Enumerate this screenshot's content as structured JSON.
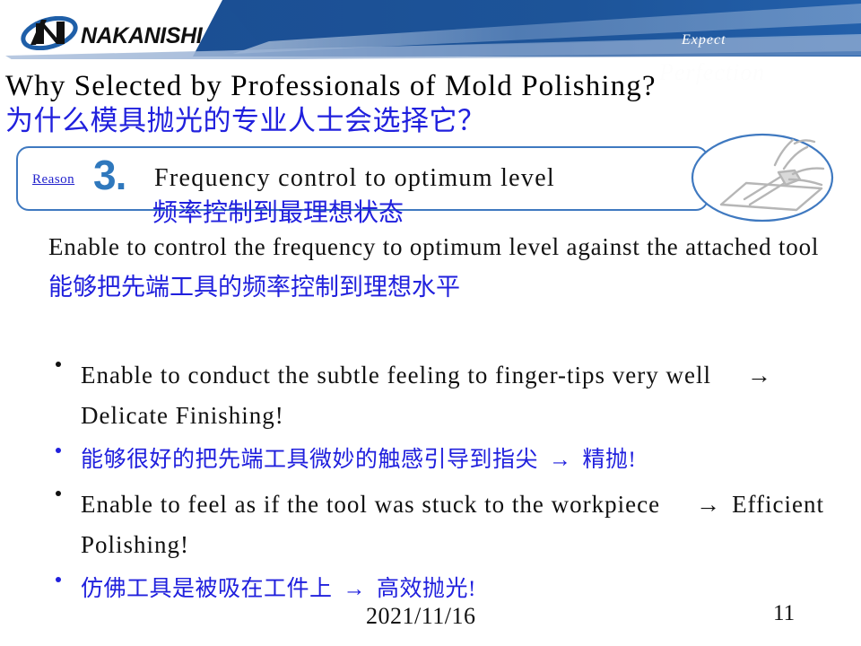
{
  "header": {
    "logo_text": "NAKANISHI",
    "logo_icon": "nakanishi-swoosh-n-logo",
    "tagline_primary": "Expect",
    "tagline_secondary": "Perfection",
    "banner_color": "#1d5499",
    "banner_light_color": "#6e92c4"
  },
  "title": {
    "english": "Why Selected by Professionals of Mold Polishing?",
    "chinese": "为什么模具抛光的专业人士会选择它？"
  },
  "reason": {
    "label": "Reason",
    "number": "3.",
    "heading_en": "Frequency control to optimum level",
    "heading_cn": "频率控制到最理想状态",
    "border_color": "#3f79c0",
    "number_color": "#2f78bd",
    "illustration_icon": "hand-holding-polishing-tool-circle-illustration"
  },
  "body": {
    "english": "Enable to control the frequency to optimum level against the attached tool",
    "chinese": "能够把先端工具的频率控制到理想水平"
  },
  "bullets": [
    {
      "lang": "en",
      "text_before": "Enable to conduct the subtle feeling to finger-tips very well",
      "arrow": "→",
      "text_after": "Delicate Finishing!"
    },
    {
      "lang": "cn",
      "text_before": "能够很好的把先端工具微妙的触感引导到指尖",
      "arrow": "→",
      "text_after": "精抛!"
    },
    {
      "lang": "en",
      "text_before": "Enable to feel as if the tool was stuck to the workpiece",
      "arrow": "→",
      "text_after": "Efficient Polishing!"
    },
    {
      "lang": "cn",
      "text_before": "仿佛工具是被吸在工件上",
      "arrow": "→",
      "text_after": "高效抛光!"
    }
  ],
  "footer": {
    "date": "2021/11/16",
    "page_number": "11"
  },
  "colors": {
    "chinese_text": "#2020dd",
    "english_text": "#111111",
    "accent_blue": "#2f78bd"
  }
}
